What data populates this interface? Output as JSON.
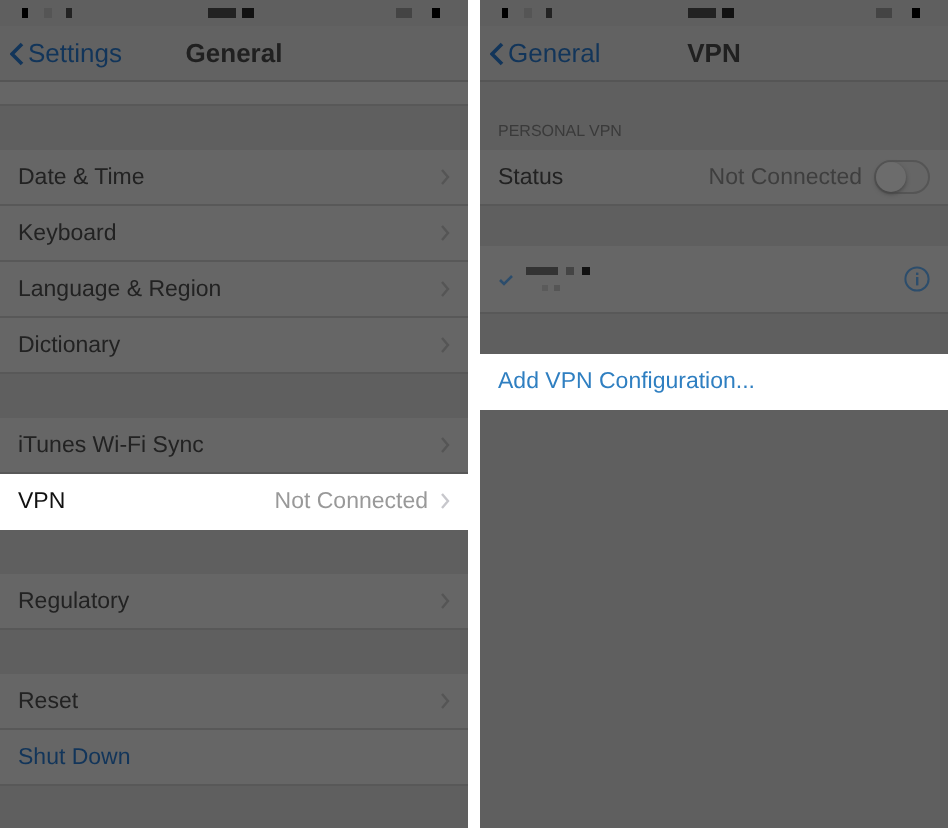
{
  "panels": [
    {
      "back": "Settings",
      "title": "General",
      "groups": [
        {
          "cut": true
        },
        {
          "rows": [
            {
              "label": "Date & Time",
              "highlighted": false,
              "chevron": true
            },
            {
              "label": "Keyboard",
              "highlighted": false,
              "chevron": true
            },
            {
              "label": "Language & Region",
              "highlighted": false,
              "chevron": true
            },
            {
              "label": "Dictionary",
              "highlighted": false,
              "chevron": true
            }
          ]
        },
        {
          "rows": [
            {
              "label": "iTunes Wi-Fi Sync",
              "highlighted": false,
              "chevron": true
            },
            {
              "label": "VPN",
              "value": "Not Connected",
              "highlighted": true,
              "chevron": true
            }
          ]
        },
        {
          "rows": [
            {
              "label": "Regulatory",
              "highlighted": false,
              "chevron": true
            }
          ]
        },
        {
          "rows": [
            {
              "label": "Reset",
              "highlighted": false,
              "chevron": true
            },
            {
              "label": "Shut Down",
              "kind": "action",
              "highlighted": false
            }
          ]
        }
      ]
    },
    {
      "back": "General",
      "title": "VPN",
      "groups": [
        {
          "header": "PERSONAL VPN",
          "rows": [
            {
              "label": "Status",
              "value": "Not Connected",
              "kind": "toggle",
              "on": false,
              "highlighted": false
            }
          ]
        },
        {
          "rows": [
            {
              "kind": "config",
              "checked": true,
              "highlighted": false
            }
          ]
        },
        {
          "rows": [
            {
              "label": "Add VPN Configuration...",
              "kind": "action",
              "highlighted": true
            }
          ]
        }
      ]
    }
  ]
}
